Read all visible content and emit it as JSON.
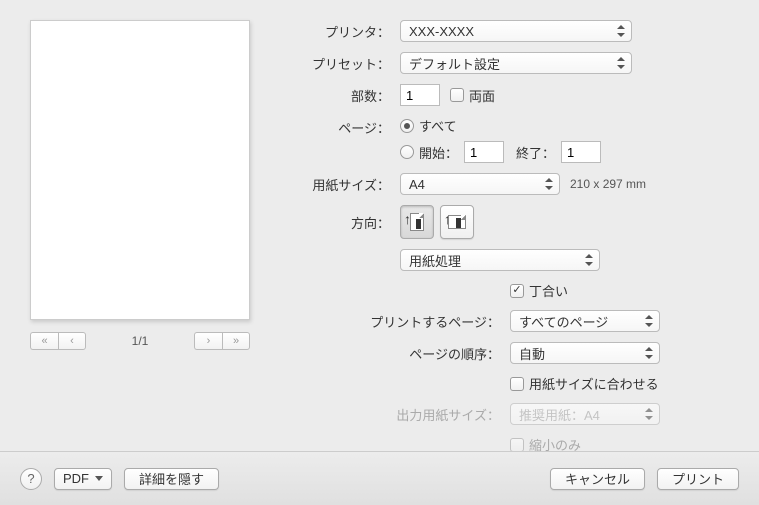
{
  "preview": {
    "page_counter": "1/1"
  },
  "labels": {
    "printer": "プリンタ：",
    "preset": "プリセット：",
    "copies": "部数：",
    "two_sided": "両面",
    "pages": "ページ：",
    "all": "すべて",
    "from": "開始：",
    "to": "終了：",
    "paper_size": "用紙サイズ：",
    "orientation": "方向：",
    "section": "用紙処理",
    "collate": "丁合い",
    "pages_to_print": "プリントするページ：",
    "page_order": "ページの順序：",
    "fit_to_paper": "用紙サイズに合わせる",
    "output_paper": "出力用紙サイズ：",
    "scale_down": "縮小のみ"
  },
  "values": {
    "printer": "XXX-XXXX",
    "preset": "デフォルト設定",
    "copies": "1",
    "from": "1",
    "to": "1",
    "paper_size": "A4",
    "paper_dims": "210 x 297 mm",
    "pages_to_print": "すべてのページ",
    "page_order": "自動",
    "output_paper": "推奨用紙：A4"
  },
  "buttons": {
    "pdf": "PDF",
    "hide_details": "詳細を隠す",
    "cancel": "キャンセル",
    "print": "プリント",
    "help": "?"
  }
}
